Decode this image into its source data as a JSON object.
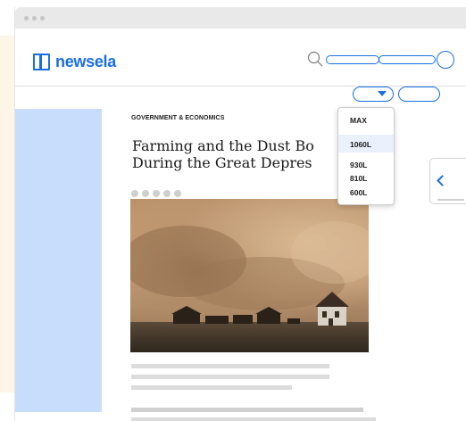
{
  "header": {
    "brand": "newsela",
    "colors": {
      "accent": "#1a6fe0",
      "sidebar": "#c8dcfb",
      "chrome": "#e9e9e9"
    },
    "icons": [
      "search-icon",
      "newsela-logo-icon"
    ]
  },
  "article": {
    "category": "GOVERNMENT & ECONOMICS",
    "title_line1": "Farming and the Dust Bo",
    "title_line2": "During the Great Depres",
    "image_alt": "Dust storm approaching farm buildings"
  },
  "level_menu": {
    "options": [
      "MAX",
      "1060L",
      "930L",
      "810L",
      "600L"
    ],
    "selected": "1060L"
  },
  "side_card": {
    "icon": "chevron-left-icon"
  }
}
